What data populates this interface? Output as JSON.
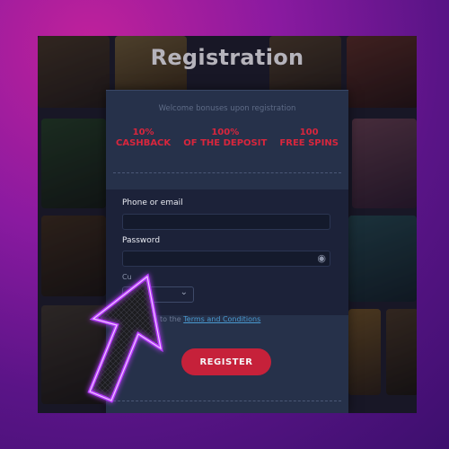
{
  "page": {
    "title": "Registration",
    "welcome": "Welcome bonuses upon registration"
  },
  "bonuses": [
    {
      "line1": "10%",
      "line2": "CASHBACK"
    },
    {
      "line1": "100%",
      "line2": "OF THE DEPOSIT"
    },
    {
      "line1": "100",
      "line2": "FREE SPINS"
    }
  ],
  "form": {
    "phone_label": "Phone or email",
    "password_label": "Password",
    "currency_label": "Cu",
    "terms_prefix": "to the",
    "terms_link": "Terms and Conditions",
    "register_label": "REGISTER"
  },
  "colors": {
    "accent_red": "#c6213a",
    "link_blue": "#4a9bd2",
    "bonus_red": "#d8263d"
  },
  "icons": [
    "eye-icon",
    "chevron-down-icon",
    "arrow-pointer-icon"
  ]
}
